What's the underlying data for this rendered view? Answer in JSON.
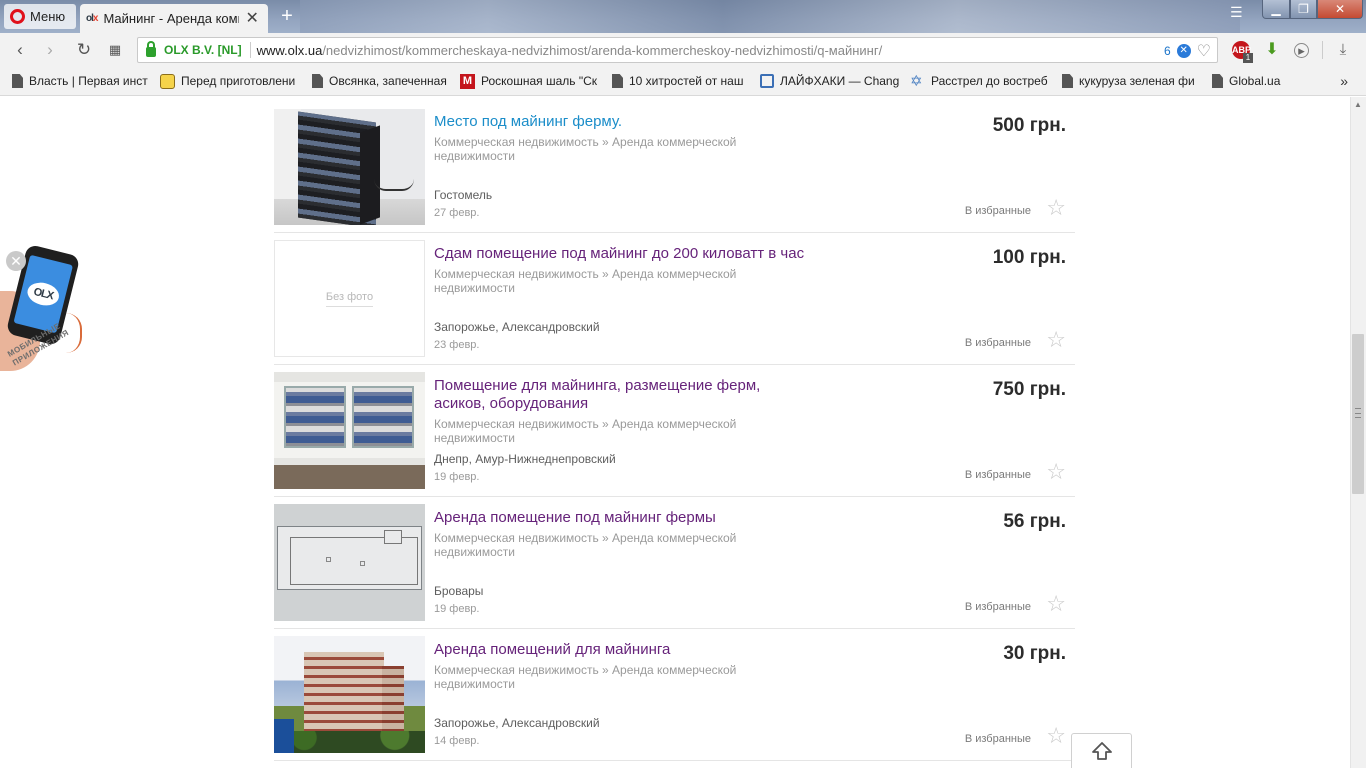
{
  "browser": {
    "menu_label": "Меню",
    "tab_title": "Майнинг - Аренда комме",
    "tab_favicon": "olx-favicon",
    "new_tab_glyph": "+",
    "cert_label": "OLX B.V. [NL]",
    "url_host": "www.olx.ua",
    "url_path": "/nedvizhimost/kommercheskaya-nedvizhimost/arenda-kommercheskoy-nedvizhimosti/q-майнинг/",
    "badge_count": "6",
    "abp_count": "1",
    "abp_label": "ABP"
  },
  "bookmarks": [
    {
      "label": "Власть | Первая инст",
      "icon": "doc-icon"
    },
    {
      "label": "Перед приготовлени",
      "icon": "panda-icon"
    },
    {
      "label": "Овсянка, запеченная",
      "icon": "doc-icon"
    },
    {
      "label": "Роскошная шаль \"Ск",
      "icon": "m-icon"
    },
    {
      "label": "10 хитростей от наш",
      "icon": "doc-icon"
    },
    {
      "label": "ЛАЙФХАКИ — Chang",
      "icon": "check-icon"
    },
    {
      "label": "Расстрел до востреб",
      "icon": "star-of-david-icon"
    },
    {
      "label": "кукуруза зеленая фи",
      "icon": "doc-icon"
    },
    {
      "label": "Global.ua",
      "icon": "doc-icon"
    }
  ],
  "promo": {
    "text_line1": "МОБИЛЬНЫЕ",
    "text_line2": "ПРИЛОЖЕНИЯ",
    "logo": "OLX"
  },
  "listings": [
    {
      "title": "Место под майнинг ферму.",
      "category": "Коммерческая недвижимость » Аренда коммерческой недвижимости",
      "location": "Гостомель",
      "date": "27 февр.",
      "price": "500 грн.",
      "fav_label": "В избранные",
      "visited": false
    },
    {
      "title": "Сдам помещение под майнинг до 200 киловатт в час",
      "category": "Коммерческая недвижимость » Аренда коммерческой недвижимости",
      "location": "Запорожье, Александровский",
      "date": "23 февр.",
      "price": "100 грн.",
      "fav_label": "В избранные",
      "no_photo_label": "Без фото",
      "visited": true
    },
    {
      "title": "Помещение для майнинга, размещение ферм, асиков, оборудования",
      "category": "Коммерческая недвижимость » Аренда коммерческой недвижимости",
      "location": "Днепр, Амур-Нижнеднепровский",
      "date": "19 февр.",
      "price": "750 грн.",
      "fav_label": "В избранные",
      "visited": true
    },
    {
      "title": "Аренда помещение под майнинг фермы",
      "category": "Коммерческая недвижимость » Аренда коммерческой недвижимости",
      "location": "Бровары",
      "date": "19 февр.",
      "price": "56 грн.",
      "fav_label": "В избранные",
      "visited": true
    },
    {
      "title": "Аренда помещений для майнинга",
      "category": "Коммерческая недвижимость » Аренда коммерческой недвижимости",
      "location": "Запорожье, Александровский",
      "date": "14 февр.",
      "price": "30 грн.",
      "fav_label": "В избранные",
      "visited": true
    }
  ],
  "colors": {
    "link_unvisited": "#1b8dc9",
    "link_visited": "#66237a",
    "price": "#2c2c2c",
    "cert_green": "#2a9a2a"
  }
}
